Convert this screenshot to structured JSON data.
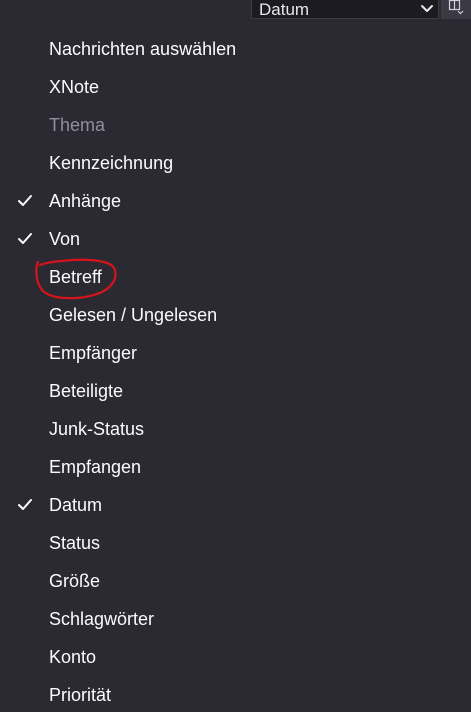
{
  "toolbar": {
    "sort_select": {
      "value": "Datum",
      "icon": "chevron-down-icon"
    },
    "column_picker": {
      "icon": "column-picker-icon"
    }
  },
  "menu": {
    "items": [
      {
        "label": "Nachrichten auswählen",
        "checked": false,
        "disabled": false
      },
      {
        "label": "XNote",
        "checked": false,
        "disabled": false
      },
      {
        "label": "Thema",
        "checked": false,
        "disabled": true
      },
      {
        "label": "Kennzeichnung",
        "checked": false,
        "disabled": false
      },
      {
        "label": "Anhänge",
        "checked": true,
        "disabled": false
      },
      {
        "label": "Von",
        "checked": true,
        "disabled": false
      },
      {
        "label": "Betreff",
        "checked": false,
        "disabled": false,
        "annotated": true
      },
      {
        "label": "Gelesen / Ungelesen",
        "checked": false,
        "disabled": false
      },
      {
        "label": "Empfänger",
        "checked": false,
        "disabled": false
      },
      {
        "label": "Beteiligte",
        "checked": false,
        "disabled": false
      },
      {
        "label": "Junk-Status",
        "checked": false,
        "disabled": false
      },
      {
        "label": "Empfangen",
        "checked": false,
        "disabled": false
      },
      {
        "label": "Datum",
        "checked": true,
        "disabled": false
      },
      {
        "label": "Status",
        "checked": false,
        "disabled": false
      },
      {
        "label": "Größe",
        "checked": false,
        "disabled": false
      },
      {
        "label": "Schlagwörter",
        "checked": false,
        "disabled": false
      },
      {
        "label": "Konto",
        "checked": false,
        "disabled": false
      },
      {
        "label": "Priorität",
        "checked": false,
        "disabled": false
      }
    ]
  },
  "annotation": {
    "shape": "hand-drawn-circle",
    "target": "Betreff",
    "color": "#d7141a"
  },
  "colors": {
    "background": "#2b2a33",
    "text": "#fbfbfe",
    "disabled_text": "#8f8f9d",
    "select_background": "#1c1b22"
  }
}
